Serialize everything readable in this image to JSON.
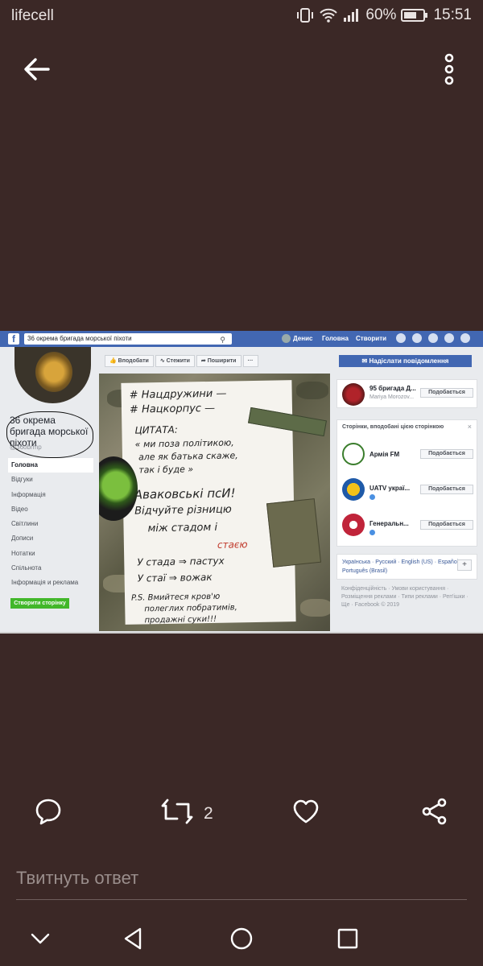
{
  "status_bar": {
    "carrier": "lifecell",
    "battery": "60%",
    "time": "15:51"
  },
  "embedded_screenshot": {
    "search_text": "36 окрема бригада морської піхоти",
    "user_name": "Денис",
    "nav": [
      "Головна",
      "Створити"
    ],
    "page_name": "36 окрема бригада морської піхоти",
    "page_handle": "@36obrmp",
    "menu": [
      "Головна",
      "Відгуки",
      "Інформація",
      "Відео",
      "Світлини",
      "Дописи",
      "Нотатки",
      "Спільнота",
      "Інформація и реклама"
    ],
    "create_page_button": "Створити сторінку",
    "actions": [
      "Вподобати",
      "Стежити",
      "Поширити",
      "···"
    ],
    "message_button": "Надіслати повідомлення",
    "suggested_page": {
      "name": "95 бригада Д...",
      "sub": "Mariya Morozov...",
      "like": "Подобається"
    },
    "liked_pages_title": "Сторінки, вподобані цією сторінкою",
    "liked_pages": [
      {
        "name": "Армія FM",
        "like": "Подобається"
      },
      {
        "name": "UATV украї...",
        "like": "Подобається"
      },
      {
        "name": "Генеральн...",
        "like": "Подобається"
      }
    ],
    "languages": "Українська · Русский · English (US) · Español · Português (Brasil)",
    "footer": "Конфіденційність · Умови користування · Розміщення реклами · Типи реклами · Реп'ішки · Ще · Facebook © 2019",
    "note_lines": [
      "# Нацдружини —",
      "# Нацкорпус —",
      "ЦИТАТА:",
      "« ми поза політикою,",
      "але як батька скаже,",
      "так і буде »",
      "Аваковські псИ!",
      "Відчуйте різницю",
      "між стадом і",
      "стаєю",
      "У стада ⇒ пастух",
      "У стаї ⇒ вожак",
      "P.S. Вмийтеся кров'ю",
      "полеглих побратимів,",
      "продажні суки!!!"
    ]
  },
  "tweet_actions": {
    "retweet_count": "2"
  },
  "reply": {
    "placeholder": "Твитнуть ответ"
  },
  "icons": {
    "back": "arrow-left-icon",
    "more": "more-vertical-icon",
    "reply": "comment-icon",
    "retweet": "retweet-icon",
    "like": "heart-icon",
    "share": "share-icon"
  },
  "colors": {
    "background": "#3b2826",
    "facebook_blue": "#4267b2",
    "facebook_green": "#42b72a"
  }
}
